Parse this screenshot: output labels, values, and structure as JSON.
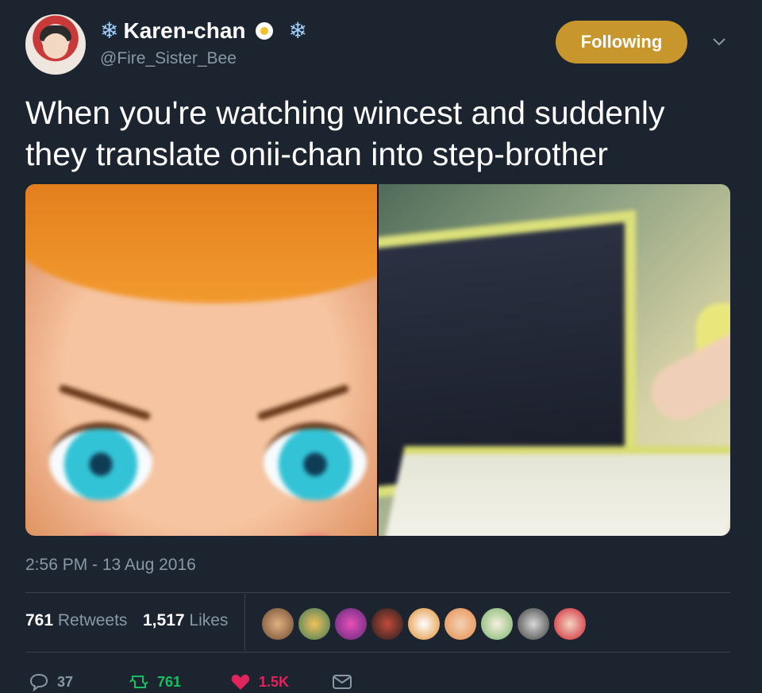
{
  "account": {
    "display_name": "Karen-chan",
    "handle": "@Fire_Sister_Bee",
    "name_emoji": [
      "snowflake-icon",
      "egg-icon",
      "snowflake-icon"
    ]
  },
  "header": {
    "follow_label": "Following"
  },
  "tweet": {
    "text_line1": "When you're watching wincest and suddenly",
    "text_line2": "they translate onii-chan into step-brother",
    "timestamp": "2:56 PM - 13 Aug 2016"
  },
  "stats": {
    "retweets_count": "761",
    "retweets_label": "Retweets",
    "likes_count": "1,517",
    "likes_label": "Likes"
  },
  "actions": {
    "reply_count": "37",
    "retweet_count": "761",
    "like_count": "1.5K"
  },
  "colors": {
    "background": "#1c2430",
    "follow_button": "#c7962d",
    "secondary_text": "#8899a6",
    "retweet_green": "#17bf63",
    "like_red": "#e0245e",
    "divider": "#38444d"
  }
}
